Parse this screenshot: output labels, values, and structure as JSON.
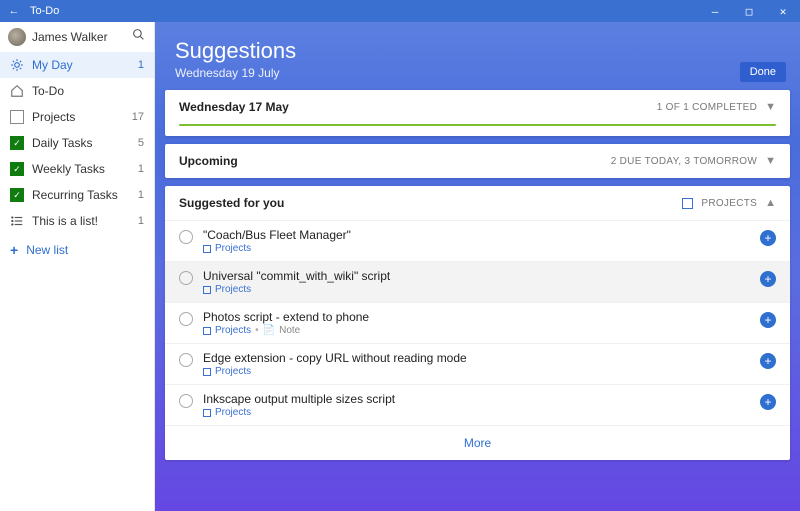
{
  "window": {
    "title": "To-Do"
  },
  "user": {
    "name": "James Walker"
  },
  "sidebar": {
    "items": [
      {
        "label": "My Day",
        "count": "1",
        "icon": "sun",
        "active": true
      },
      {
        "label": "To-Do",
        "count": "",
        "icon": "home",
        "active": false
      },
      {
        "label": "Projects",
        "count": "17",
        "icon": "proj",
        "active": false
      },
      {
        "label": "Daily Tasks",
        "count": "5",
        "icon": "check",
        "active": false
      },
      {
        "label": "Weekly Tasks",
        "count": "1",
        "icon": "check",
        "active": false
      },
      {
        "label": "Recurring Tasks",
        "count": "1",
        "icon": "check",
        "active": false
      },
      {
        "label": "This is a list!",
        "count": "1",
        "icon": "lines",
        "active": false
      }
    ],
    "new_list": "New list"
  },
  "hero": {
    "title": "Suggestions",
    "date": "Wednesday 19 July",
    "done": "Done"
  },
  "sections": {
    "completed": {
      "label": "Wednesday 17 May",
      "meta": "1 OF 1 COMPLETED"
    },
    "upcoming": {
      "label": "Upcoming",
      "meta": "2 DUE TODAY, 3 TOMORROW"
    },
    "suggested": {
      "label": "Suggested for you",
      "meta": "PROJECTS"
    }
  },
  "tasks": [
    {
      "title": "\"Coach/Bus Fleet Manager\"",
      "list": "Projects",
      "note": ""
    },
    {
      "title": "Universal \"commit_with_wiki\" script",
      "list": "Projects",
      "note": ""
    },
    {
      "title": "Photos script - extend to phone",
      "list": "Projects",
      "note": "Note"
    },
    {
      "title": "Edge extension - copy URL without reading mode",
      "list": "Projects",
      "note": ""
    },
    {
      "title": "Inkscape output multiple sizes script",
      "list": "Projects",
      "note": ""
    }
  ],
  "more": "More"
}
